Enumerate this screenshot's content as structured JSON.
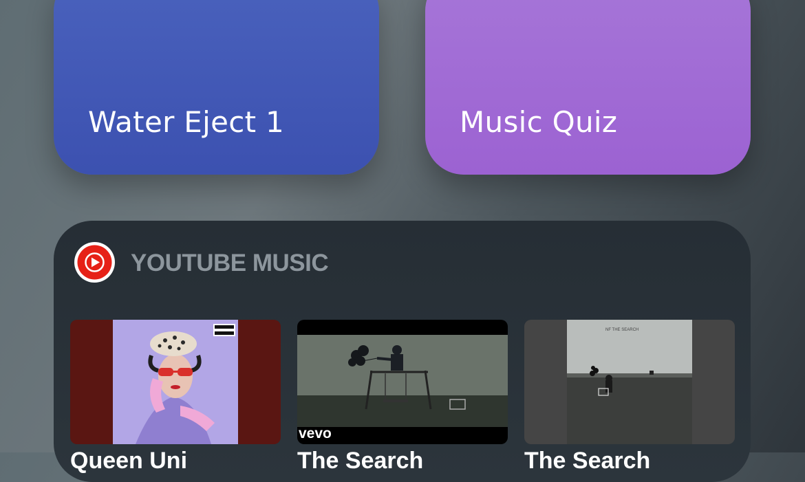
{
  "shortcuts": [
    {
      "label": "Water Eject 1",
      "color": "#4257b6"
    },
    {
      "label": "Music Quiz",
      "color": "#a26bd5"
    }
  ],
  "widget": {
    "title": "YOUTUBE MUSIC",
    "logo_icon": "youtube-music-icon",
    "videos": [
      {
        "title": "Queen Uni",
        "badge": "PARENTAL ADVISORY EXPLICIT CONTENT"
      },
      {
        "title": "The Search",
        "badge": "vevo"
      },
      {
        "title": "The Search",
        "badge": "NF THE SEARCH"
      }
    ]
  }
}
